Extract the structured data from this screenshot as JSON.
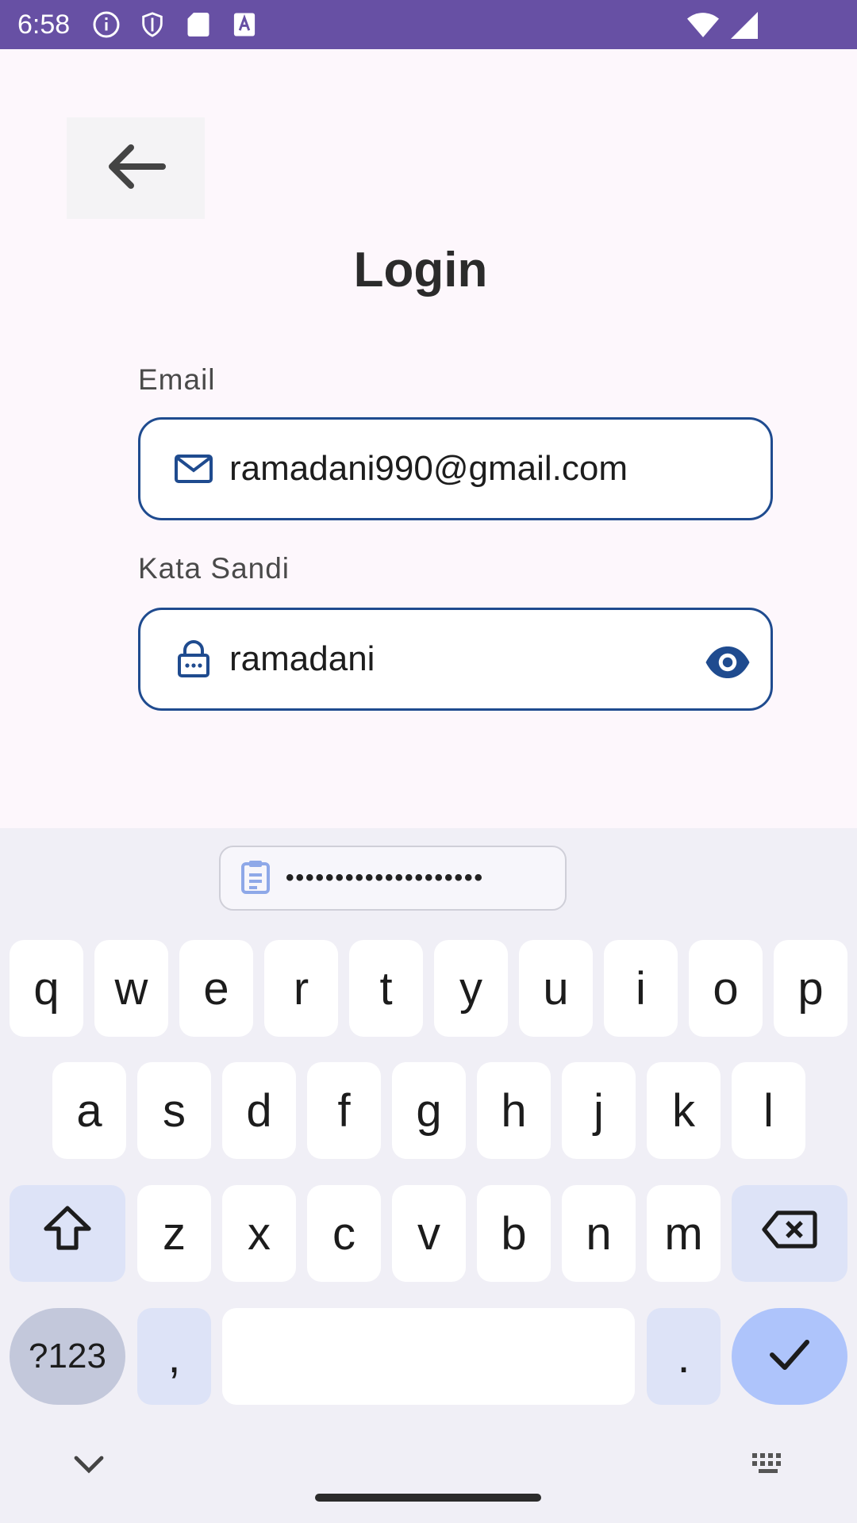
{
  "status_bar": {
    "time": "6:58",
    "left_icons": [
      "info-icon",
      "shield-icon",
      "sd-card-icon",
      "text-a-icon"
    ],
    "right_icons": [
      "wifi-icon",
      "signal-icon"
    ],
    "background": "#6750a4"
  },
  "page": {
    "title": "Login",
    "back_icon": "arrow-back-icon"
  },
  "form": {
    "email": {
      "label": "Email",
      "value": "ramadani990@gmail.com",
      "icon": "mail-icon"
    },
    "password": {
      "label": "Kata Sandi",
      "value": "ramadani",
      "icon": "lock-icon",
      "toggle_icon": "eye-icon"
    },
    "border_color": "#1f4b8f"
  },
  "keyboard": {
    "clipboard_suggestion": "••••••••••••••••••••",
    "row1": [
      "q",
      "w",
      "e",
      "r",
      "t",
      "y",
      "u",
      "i",
      "o",
      "p"
    ],
    "row2": [
      "a",
      "s",
      "d",
      "f",
      "g",
      "h",
      "j",
      "k",
      "l"
    ],
    "row3": [
      "z",
      "x",
      "c",
      "v",
      "b",
      "n",
      "m"
    ],
    "symbols_key": "?123",
    "comma_key": ",",
    "period_key": ".",
    "shift_icon": "shift-icon",
    "backspace_icon": "backspace-icon",
    "enter_icon": "check-icon",
    "hide_icon": "chevron-down-icon",
    "switch_icon": "keyboard-icon"
  }
}
